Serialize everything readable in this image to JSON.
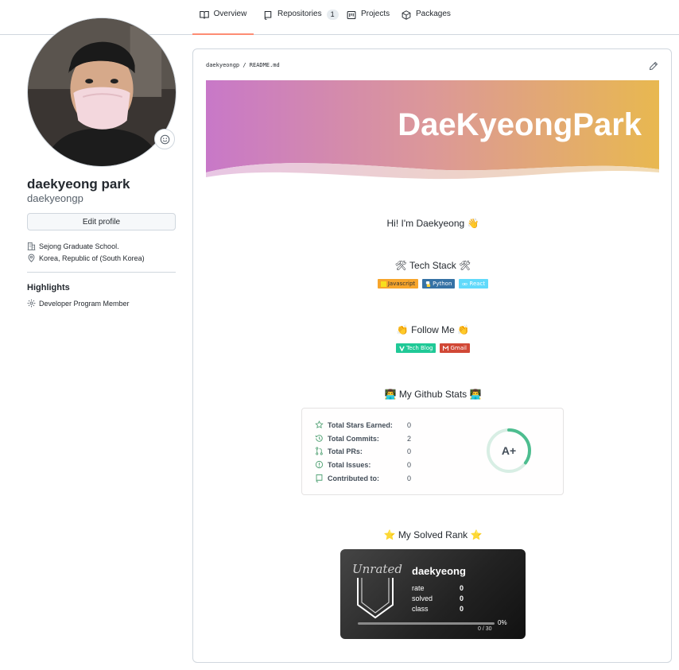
{
  "nav": {
    "tabs": [
      {
        "label": "Overview",
        "icon": "book-icon",
        "active": true
      },
      {
        "label": "Repositories",
        "icon": "repo-icon",
        "count": "1"
      },
      {
        "label": "Projects",
        "icon": "project-icon"
      },
      {
        "label": "Packages",
        "icon": "package-icon"
      }
    ]
  },
  "profile": {
    "full_name": "daekyeong park",
    "login": "daekyeongp",
    "edit_label": "Edit profile",
    "organization": "Sejong Graduate School.",
    "location": "Korea, Republic of (South Korea)",
    "highlights_title": "Highlights",
    "highlight_item": "Developer Program Member"
  },
  "readme": {
    "path": "daekyeongp / README.md",
    "banner_title": "DaeKyeongPark",
    "greeting": "Hi! I'm Daekyeong",
    "tech_stack_title": "Tech Stack",
    "tech_badges": [
      {
        "label": "Javascript",
        "color": "#f7a52b"
      },
      {
        "label": "Python",
        "color": "#3572a5"
      },
      {
        "label": "React",
        "color": "#61dafb"
      }
    ],
    "follow_title": "Follow Me",
    "follow_badges": [
      {
        "label": "Tech Blog",
        "color": "#20c997"
      },
      {
        "label": "Gmail",
        "color": "#d14836"
      }
    ],
    "stats_title": "My Github Stats",
    "stats": [
      {
        "label": "Total Stars Earned:",
        "value": "0"
      },
      {
        "label": "Total Commits:",
        "value": "2"
      },
      {
        "label": "Total PRs:",
        "value": "0"
      },
      {
        "label": "Total Issues:",
        "value": "0"
      },
      {
        "label": "Contributed to:",
        "value": "0"
      }
    ],
    "rank": "A+",
    "rank_progress": 0.35,
    "solved_title": "My Solved Rank",
    "solved": {
      "tier": "Unrated",
      "username": "daekyeong",
      "rows": [
        {
          "label": "rate",
          "value": "0"
        },
        {
          "label": "solved",
          "value": "0"
        },
        {
          "label": "class",
          "value": "0"
        }
      ],
      "percent": "0%",
      "progress_fraction": "0 / 30",
      "progress_value": 0
    }
  },
  "colors": {
    "tab_active_underline": "#fd8c73",
    "banner_left": "#c878c8",
    "banner_right": "#e8b850",
    "ring_color": "#4dbd8f"
  }
}
